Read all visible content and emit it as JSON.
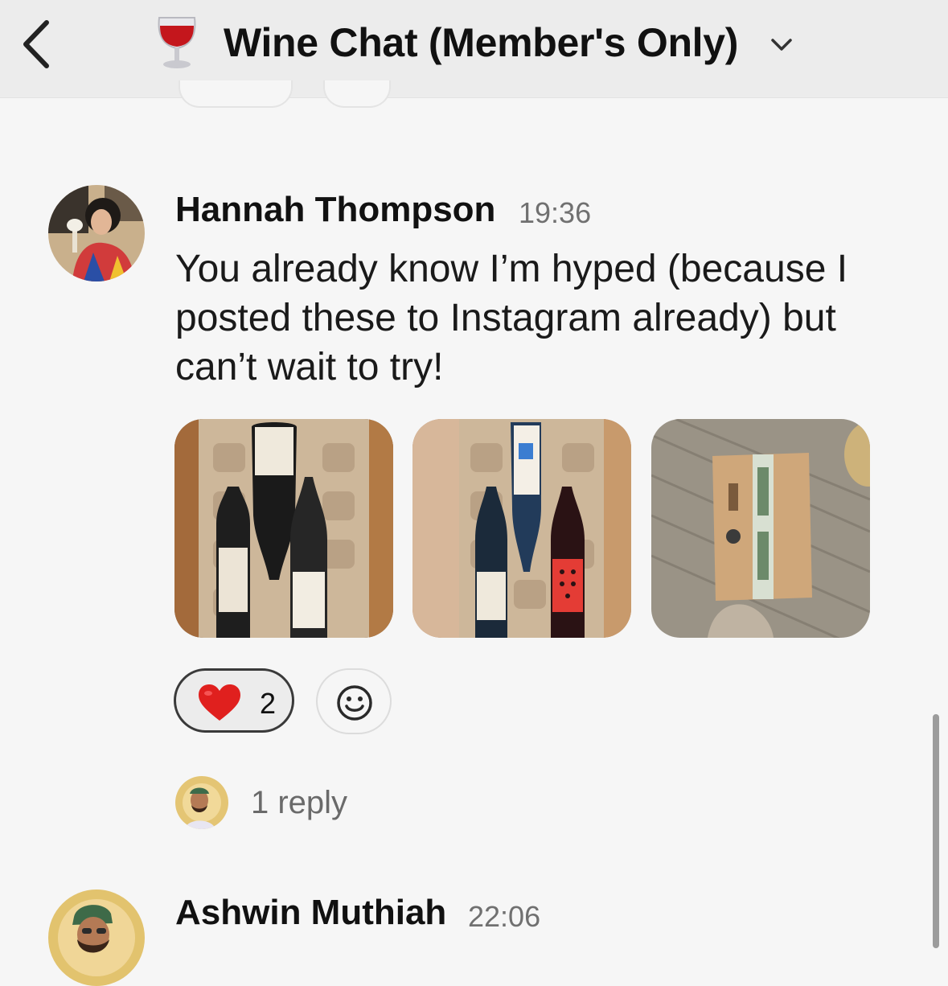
{
  "header": {
    "channel_emoji": "wine-glass-icon",
    "channel_name": "Wine Chat (Member's Only)"
  },
  "messages": [
    {
      "author": "Hannah Thompson",
      "time": "19:36",
      "text": "You already know I’m hyped (because I posted these to Instagram already) but can’t wait to try!",
      "attachments": [
        "wine-box-photo-1",
        "wine-box-photo-2",
        "wine-package-photo"
      ],
      "reaction": {
        "icon": "heart-icon",
        "count": "2"
      },
      "replies": "1 reply"
    },
    {
      "author": "Ashwin Muthiah",
      "time": "22:06"
    }
  ],
  "colors": {
    "background": "#f6f6f6",
    "header": "#ececec",
    "heart": "#e0201e",
    "muted_text": "#707070"
  }
}
